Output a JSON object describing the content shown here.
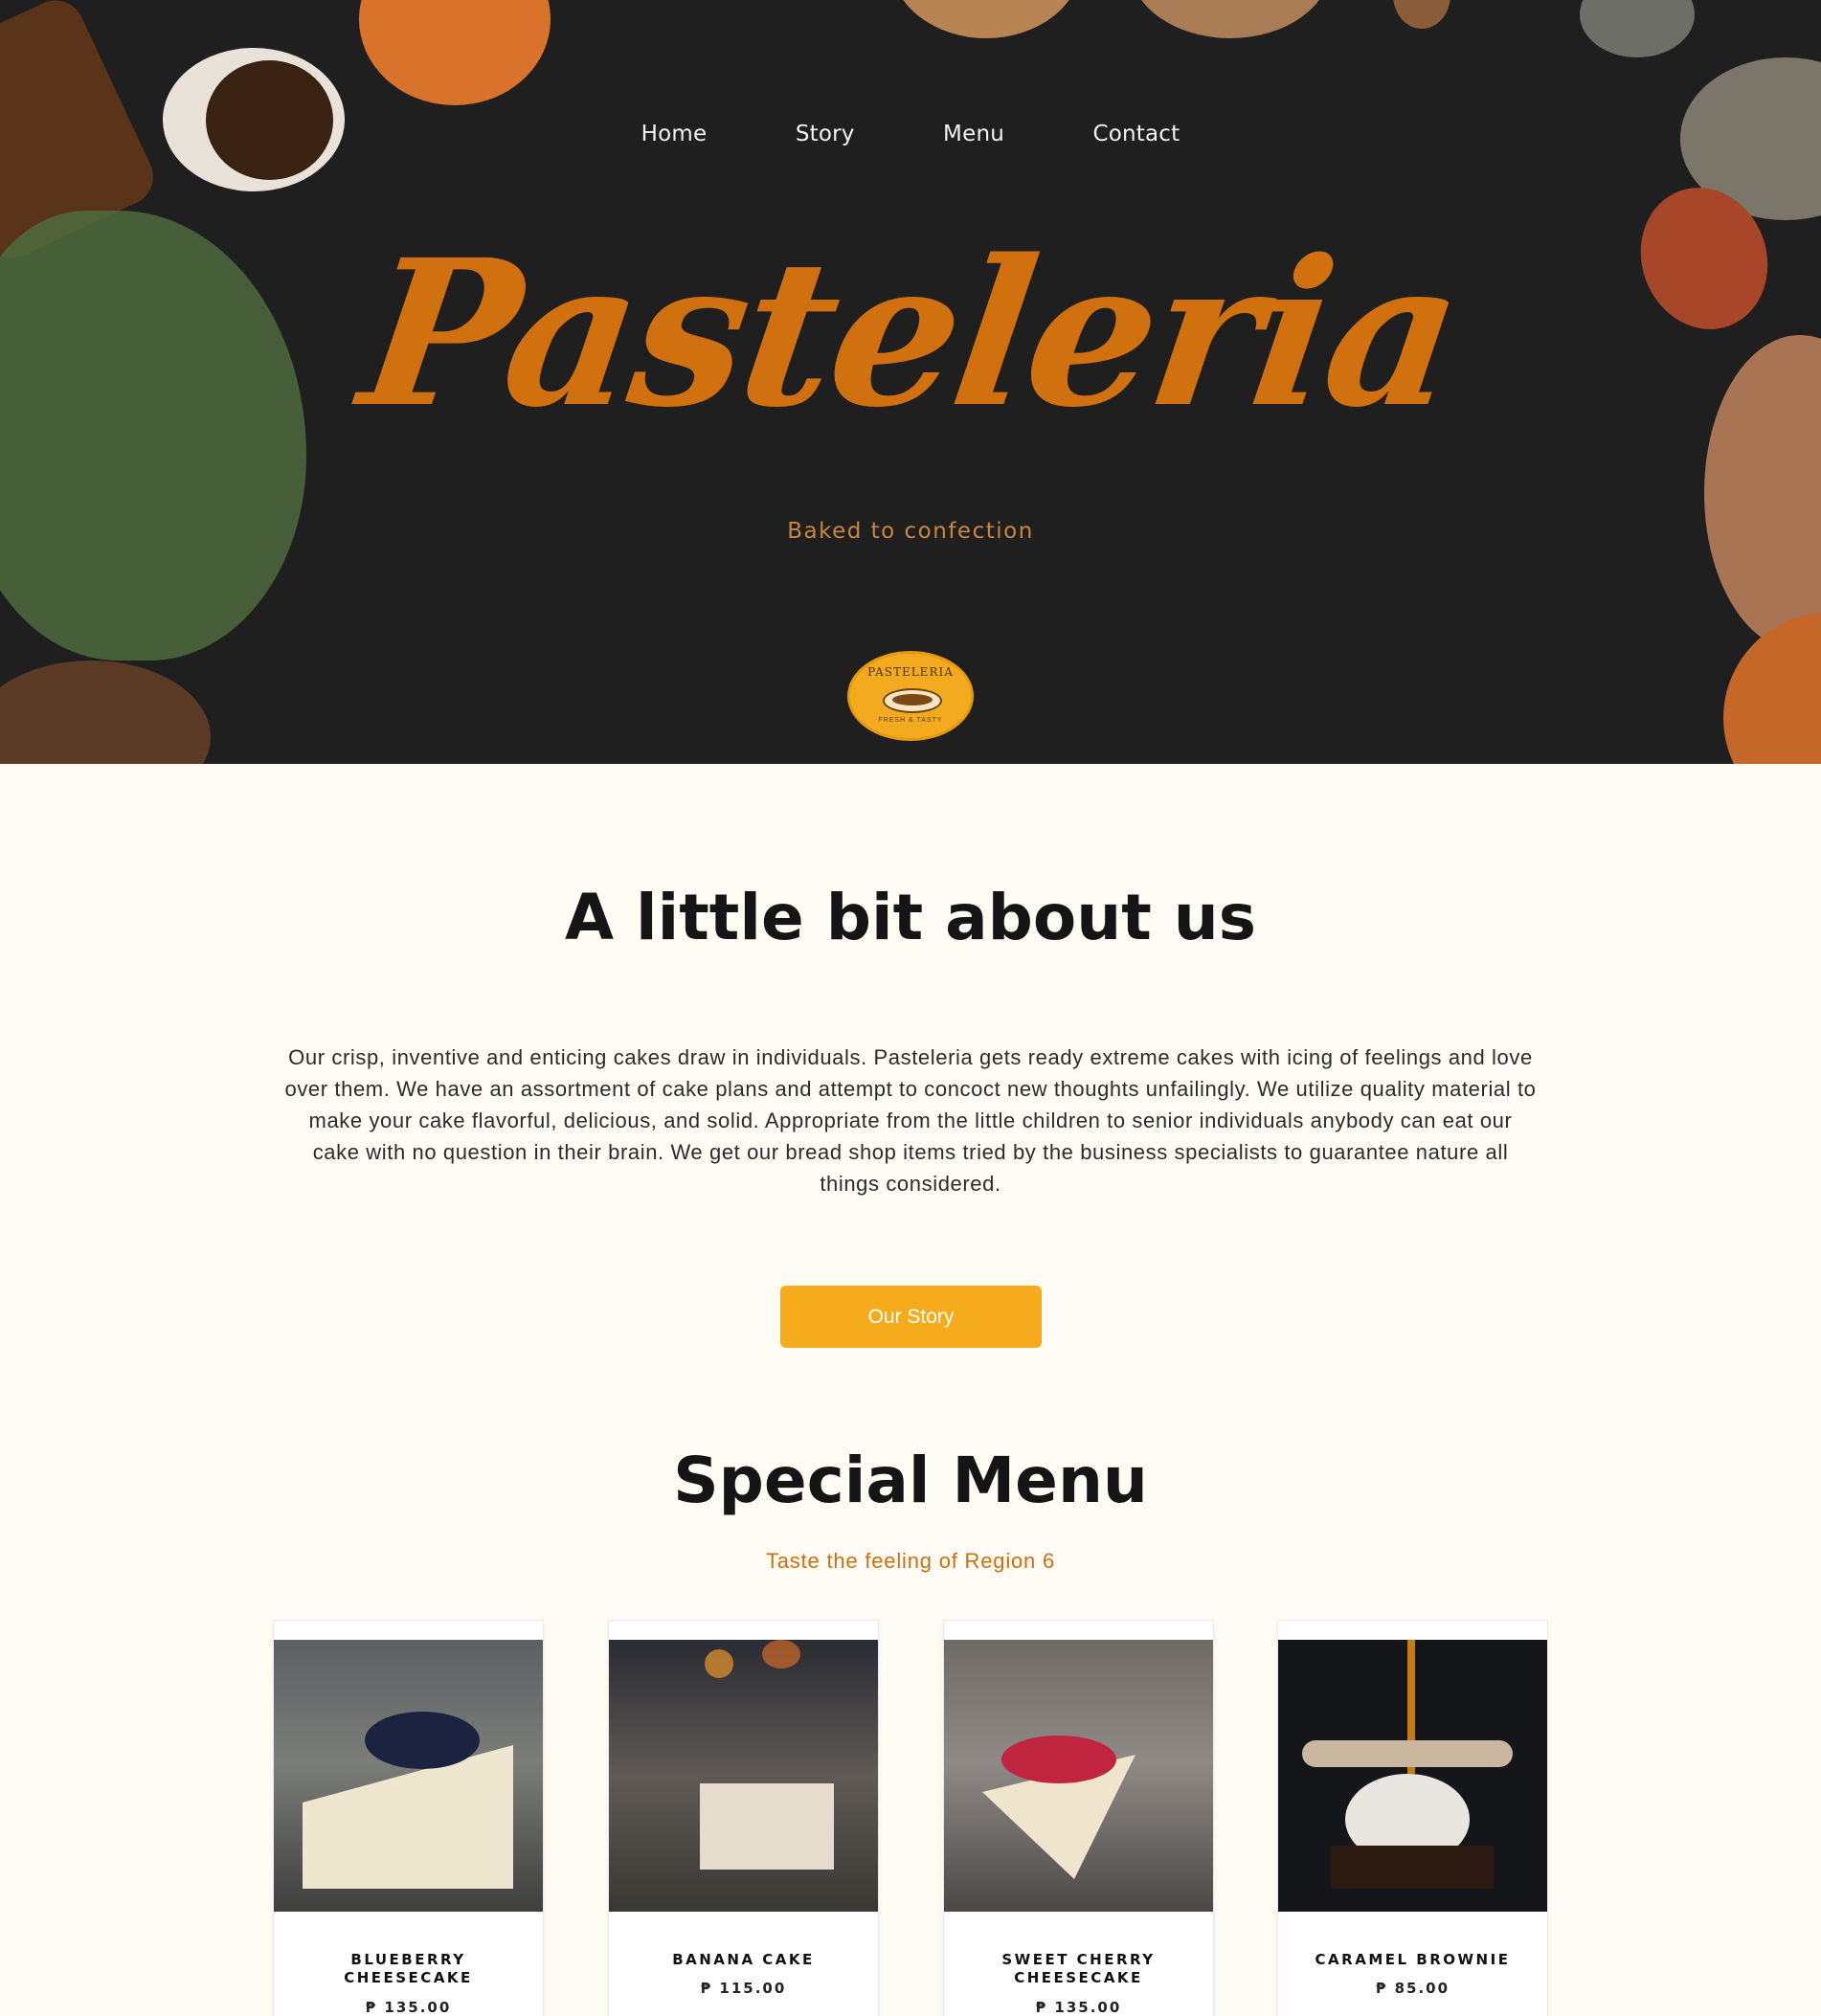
{
  "nav": {
    "items": [
      "Home",
      "Story",
      "Menu",
      "Contact"
    ]
  },
  "hero": {
    "brand": "Pasteleria",
    "tagline": "Baked to confection",
    "logo_text": "PASTELERIA",
    "logo_subtext": "FRESH & TASTY"
  },
  "about": {
    "title": "A little bit about us",
    "body": "Our crisp, inventive and enticing cakes draw in individuals. Pasteleria gets ready extreme cakes with icing of feelings and love over them. We have an assortment of cake plans and attempt to concoct new thoughts unfailingly. We utilize quality material to make your cake flavorful, delicious, and solid. Appropriate from the little children to senior individuals anybody can eat our cake with no question in their brain. We get our bread shop items tried by the business specialists to guarantee nature all things considered.",
    "button_label": "Our Story"
  },
  "special_menu": {
    "title": "Special Menu",
    "subtitle": "Taste the feeling of Region 6",
    "items": [
      {
        "name": "BLUEBERRY CHEESECAKE",
        "price": "₱ 135.00"
      },
      {
        "name": "BANANA CAKE",
        "price": "₱ 115.00"
      },
      {
        "name": "SWEET CHERRY CHEESECAKE",
        "price": "₱ 135.00"
      },
      {
        "name": "CARAMEL BROWNIE",
        "price": "₱ 85.00"
      }
    ]
  },
  "colors": {
    "hero_bg": "#201f20",
    "brand": "#d0700f",
    "accent_button": "#f5ab1c",
    "page_bg": "#fffcf5"
  }
}
